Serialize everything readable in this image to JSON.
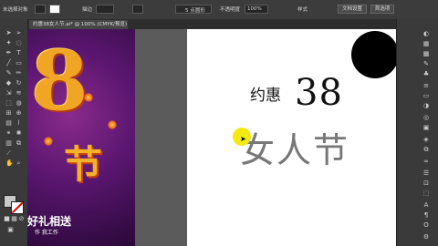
{
  "control_bar": {
    "selection_label": "未选择对象",
    "stroke_label": "描边",
    "point_style": "5 点圆形",
    "opacity_label": "不透明度",
    "opacity_value": "100%",
    "style_label": "样式",
    "doc_setup": "文档设置",
    "preferences": "首选项"
  },
  "document_tab": {
    "title": "约惠38女人节.ai* @ 100% (CMYK/预览)",
    "close": "×"
  },
  "poster": {
    "big_number": "8",
    "festival": "节",
    "headline": "好礼相送",
    "subline": "作  我工作"
  },
  "artboard": {
    "line1_small": "约惠",
    "line1_number": "38",
    "line2": "女人节"
  },
  "icons": {
    "tools": [
      "selection-icon",
      "direct-selection-icon",
      "magic-wand-icon",
      "lasso-icon",
      "pen-icon",
      "type-icon",
      "line-icon",
      "rectangle-icon",
      "paintbrush-icon",
      "pencil-icon",
      "eraser-icon",
      "rotate-icon",
      "scale-icon",
      "width-icon",
      "free-transform-icon",
      "shape-builder-icon",
      "perspective-icon",
      "mesh-icon",
      "gradient-icon",
      "eyedropper-icon",
      "blend-icon",
      "symbol-sprayer-icon",
      "graph-icon",
      "artboard-icon",
      "slice-icon",
      "hand-icon",
      "zoom-icon"
    ],
    "panels": [
      "color-panel-icon",
      "color-guide-icon",
      "swatches-icon",
      "brushes-icon",
      "symbols-icon",
      "stroke-icon",
      "gradient-panel-icon",
      "transparency-icon",
      "appearance-icon",
      "graphic-styles-icon",
      "layers-icon",
      "artboards-panel-icon",
      "links-icon",
      "align-icon",
      "pathfinder-icon",
      "transform-icon",
      "character-icon",
      "paragraph-icon",
      "opentype-icon",
      "properties-icon"
    ]
  },
  "colors": {
    "poster_gold": "#f0a524",
    "poster_purple": "#5a1670",
    "highlight_yellow": "#f2ea12"
  }
}
